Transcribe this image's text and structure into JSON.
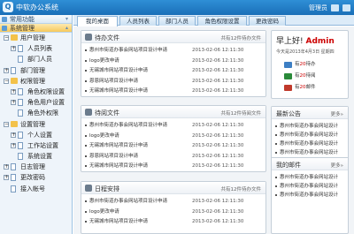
{
  "header": {
    "title": "中软办公系统",
    "admin_label": "管理员"
  },
  "sidebar": {
    "groups": [
      {
        "label": "常用功能"
      },
      {
        "label": "系统管理"
      }
    ],
    "tree": [
      {
        "label": "用户管理",
        "level": 1,
        "box": "−",
        "kind": "folder"
      },
      {
        "label": "人员列表",
        "level": 2,
        "box": "+",
        "kind": "doc"
      },
      {
        "label": "部门人员",
        "level": 2,
        "box": "",
        "kind": "doc"
      },
      {
        "label": "部门管理",
        "level": 1,
        "box": "+",
        "kind": "doc"
      },
      {
        "label": "权限管理",
        "level": 1,
        "box": "−",
        "kind": "folder"
      },
      {
        "label": "角色权限设置",
        "level": 2,
        "box": "+",
        "kind": "doc"
      },
      {
        "label": "角色用户设置",
        "level": 2,
        "box": "+",
        "kind": "doc"
      },
      {
        "label": "角色外权限",
        "level": 2,
        "box": "",
        "kind": "doc"
      },
      {
        "label": "设置管理",
        "level": 1,
        "box": "−",
        "kind": "folder"
      },
      {
        "label": "个人设置",
        "level": 2,
        "box": "+",
        "kind": "doc"
      },
      {
        "label": "工作站设置",
        "level": 2,
        "box": "+",
        "kind": "doc"
      },
      {
        "label": "系统设置",
        "level": 2,
        "box": "",
        "kind": "doc"
      },
      {
        "label": "日志管理",
        "level": 1,
        "box": "+",
        "kind": "doc"
      },
      {
        "label": "更改密码",
        "level": 1,
        "box": "+",
        "kind": "doc"
      },
      {
        "label": "接入帐号",
        "level": 1,
        "box": "",
        "kind": "doc"
      }
    ]
  },
  "tabs": [
    {
      "label": "我的桌面",
      "active": true
    },
    {
      "label": "人员列表",
      "active": false
    },
    {
      "label": "部门人员",
      "active": false
    },
    {
      "label": "角色权限设置",
      "active": false
    },
    {
      "label": "更改密码",
      "active": false
    }
  ],
  "panels": {
    "pending": {
      "title": "待办文件",
      "count": "共有12件待办文件",
      "rows": [
        {
          "text": "惠州市街道办事会网站项目设计申请",
          "date": "2013-02-06  12:11:30"
        },
        {
          "text": "logo更改申请",
          "date": "2013-02-06  12:11:30"
        },
        {
          "text": "无锡城市网站项目设计申请",
          "date": "2013-02-06  12:11:30"
        },
        {
          "text": "恩恩网站项目设计申请",
          "date": "2013-02-06  12:11:30"
        },
        {
          "text": "无锡城市网站项目设计申请",
          "date": "2013-02-06  12:11:30"
        }
      ]
    },
    "read": {
      "title": "待阅文件",
      "count": "共有12件待阅文件",
      "rows": [
        {
          "text": "惠州市街道办事会网站项目设计申请",
          "date": "2013-02-06  12:11:30"
        },
        {
          "text": "logo更改申请",
          "date": "2013-02-06  12:11:30"
        },
        {
          "text": "无锡城市网站项目设计申请",
          "date": "2013-02-06  12:11:30"
        },
        {
          "text": "恩恩网站项目设计申请",
          "date": "2013-02-06  12:11:30"
        },
        {
          "text": "无锡城市网站项目设计申请",
          "date": "2013-02-06  12:11:30"
        }
      ]
    },
    "schedule": {
      "title": "日程安排",
      "count": "共有12件待办文件",
      "rows": [
        {
          "text": "惠州市街道办事会网站项目设计申请",
          "date": "2013-02-06  12:11:30"
        },
        {
          "text": "logo更改申请",
          "date": "2013-02-06  12:11:30"
        },
        {
          "text": "无锡城市网站项目设计申请",
          "date": "2013-02-06  12:11:30"
        }
      ]
    },
    "welcome": {
      "greeting": "早上好!",
      "name": "Admin",
      "today": "今天是2013年4月3日  星期四",
      "stats": [
        {
          "pre": "有",
          "num": "20",
          "post": "待办",
          "icon_color": "#3d7fc4"
        },
        {
          "pre": "有",
          "num": "20",
          "post": "待阅",
          "icon_color": "#2a8a3a"
        },
        {
          "pre": "有",
          "num": "20",
          "post": "邮件",
          "icon_color": "#c0392b"
        }
      ]
    },
    "news": {
      "title": "最新公告",
      "more": "更多»",
      "rows": [
        {
          "text": "惠州市街道办事会网站设计"
        },
        {
          "text": "惠州市街道办事会网站设计"
        },
        {
          "text": "惠州市街道办事会网站设计"
        },
        {
          "text": "惠州市街道办事会网站设计"
        }
      ]
    },
    "mail": {
      "title": "我的邮件",
      "more": "更多»",
      "rows": [
        {
          "text": "惠州市街道办事会网站设计"
        },
        {
          "text": "惠州市街道办事会网站设计"
        },
        {
          "text": "惠州市街道办事会网站设计"
        }
      ]
    }
  }
}
